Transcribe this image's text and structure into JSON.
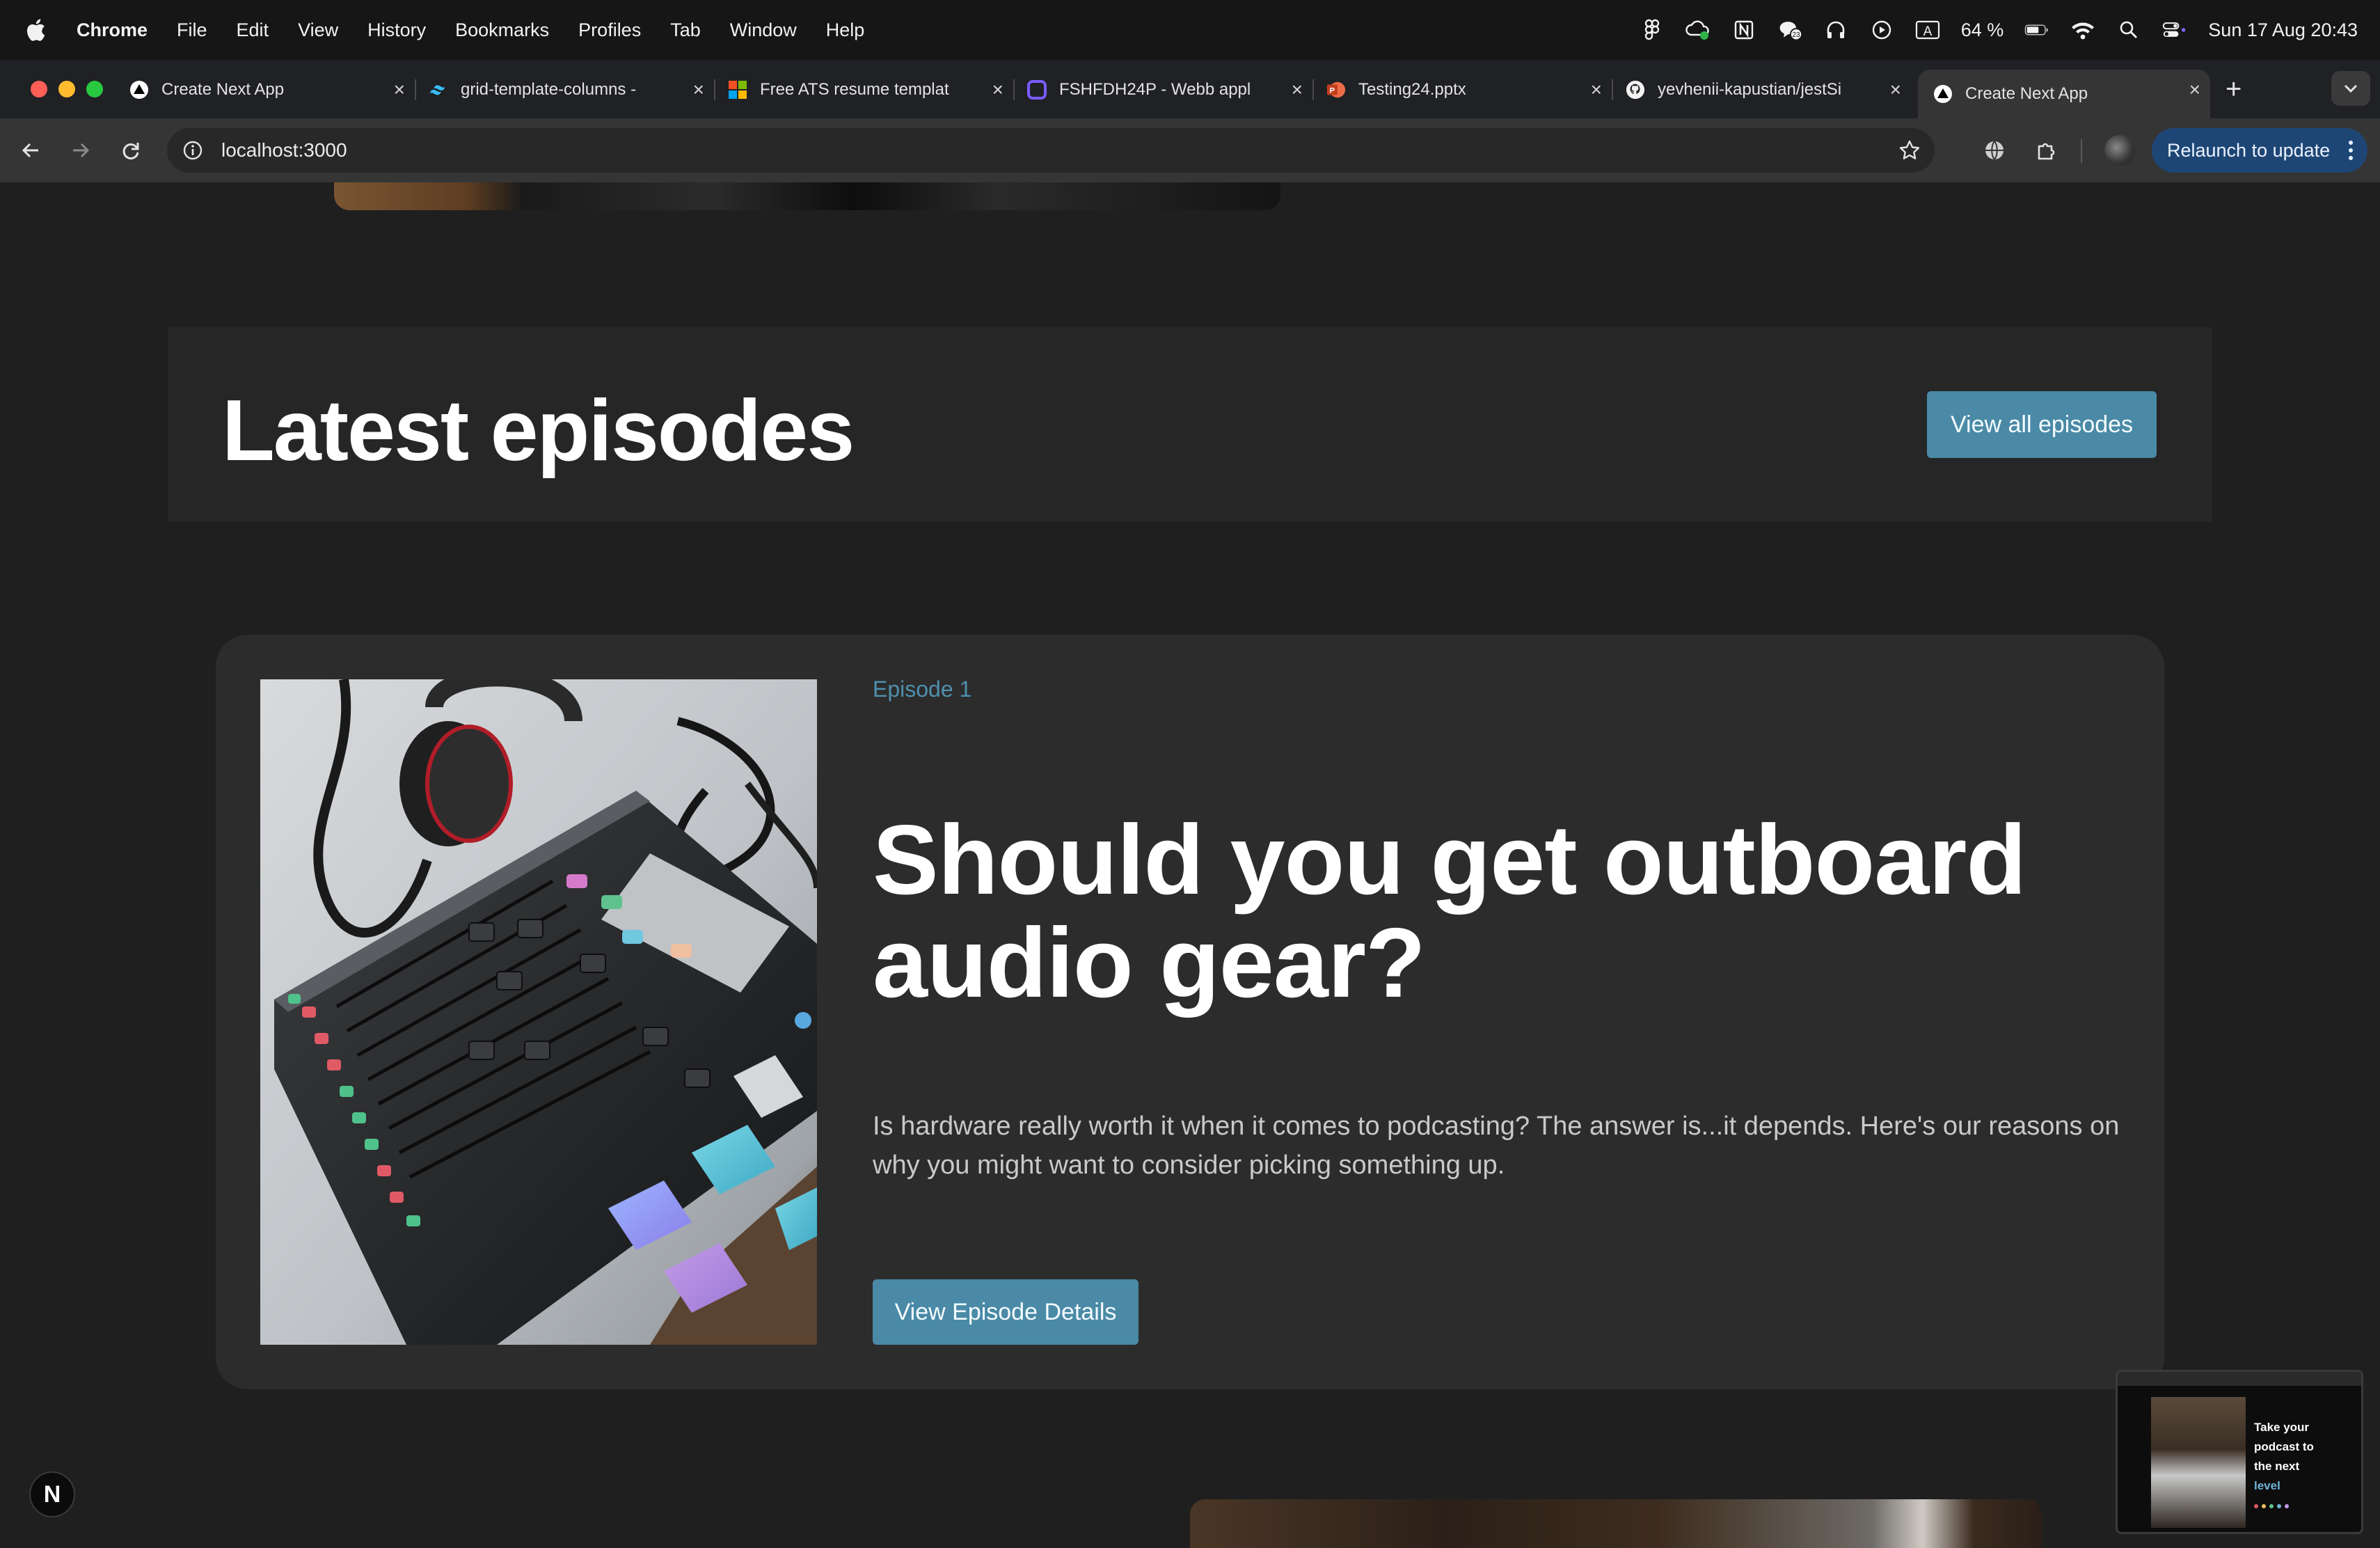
{
  "menubar": {
    "app": "Chrome",
    "items": [
      "File",
      "Edit",
      "View",
      "History",
      "Bookmarks",
      "Profiles",
      "Tab",
      "Window",
      "Help"
    ],
    "battery": "64 %",
    "datetime": "Sun 17 Aug  20:43"
  },
  "tabs": [
    {
      "title": "Create Next App",
      "icon": "nextjs-icon"
    },
    {
      "title": "grid-template-columns -",
      "icon": "tailwind-icon"
    },
    {
      "title": "Free ATS resume templat",
      "icon": "microsoft-icon"
    },
    {
      "title": "FSHFDH24P - Webb appl",
      "icon": "canvas-icon"
    },
    {
      "title": "Testing24.pptx",
      "icon": "powerpoint-icon"
    },
    {
      "title": "yevhenii-kapustian/jestSi",
      "icon": "github-icon"
    },
    {
      "title": "Create Next App",
      "icon": "nextjs-icon",
      "active": true
    }
  ],
  "toolbar": {
    "url": "localhost:3000",
    "relaunch_label": "Relaunch to update"
  },
  "section": {
    "title": "Latest episodes",
    "view_all_label": "View all episodes"
  },
  "episode": {
    "label": "Episode 1",
    "title": "Should you get outboard audio gear?",
    "description": "Is hardware really worth it when it comes to podcasting? The answer is...it depends. Here's our reasons on why you might want to consider picking something up.",
    "button_label": "View Episode Details"
  },
  "pip": {
    "text_line1": "Take your",
    "text_line2": "podcast to",
    "text_line3": "the next",
    "text_highlight": "level"
  },
  "next_badge": "N",
  "colors": {
    "accent": "#4a8aa6",
    "episode_label": "#4e90ad",
    "background": "#1f1f1f",
    "card": "#2c2c2c",
    "relaunch": "#1e4675"
  }
}
